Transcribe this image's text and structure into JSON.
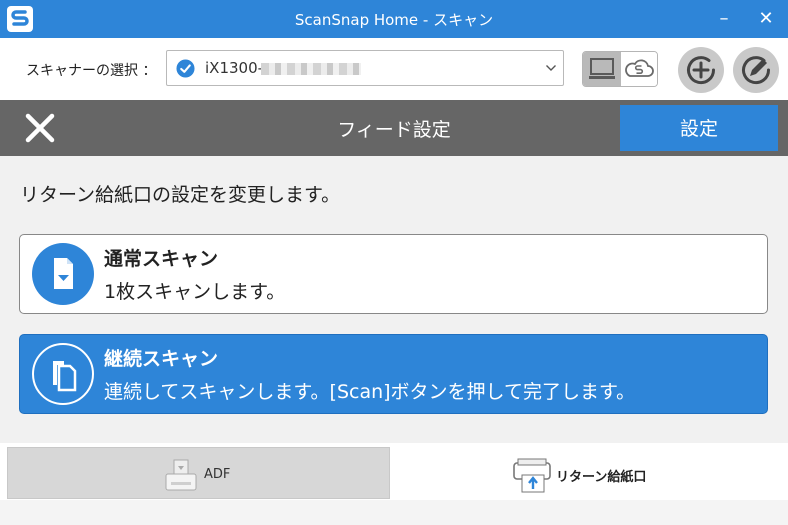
{
  "window": {
    "title": "ScanSnap Home - スキャン",
    "minimize": "–",
    "close": "✕"
  },
  "scanner": {
    "label": "スキャナーの選択 ：",
    "selected_model": "iX1300-",
    "connection_modes": [
      "pc-icon",
      "cloud-icon"
    ]
  },
  "header": {
    "title": "フィード設定",
    "settings_label": "設定"
  },
  "instruction": "リターン給紙口の設定を変更します。",
  "options": [
    {
      "title": "通常スキャン",
      "desc": "1枚スキャンします。",
      "selected": false
    },
    {
      "title": "継続スキャン",
      "desc": "連続してスキャンします。[Scan]ボタンを押して完了します。",
      "selected": true
    }
  ],
  "tabs": [
    {
      "label": "ADF",
      "icon": "adf-icon",
      "active": false
    },
    {
      "label": "リターン給紙口",
      "icon": "return-feeder-icon",
      "active": true
    }
  ],
  "colors": {
    "accent": "#2e85d8",
    "header": "#666666"
  }
}
